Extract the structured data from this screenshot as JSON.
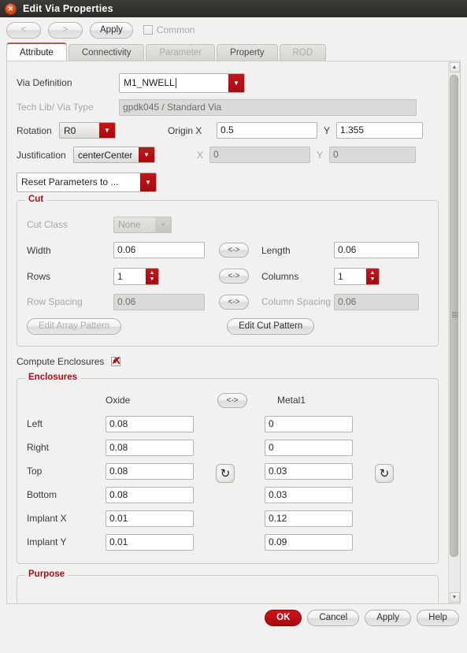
{
  "window": {
    "title": "Edit Via Properties",
    "close_icon": "close-icon"
  },
  "toolbar": {
    "prev_label": "<",
    "next_label": ">",
    "apply_label": "Apply",
    "common_label": "Common",
    "common_checked": false
  },
  "tabs": [
    {
      "label": "Attribute",
      "state": "active"
    },
    {
      "label": "Connectivity",
      "state": "enabled"
    },
    {
      "label": "Parameter",
      "state": "disabled"
    },
    {
      "label": "Property",
      "state": "enabled"
    },
    {
      "label": "ROD",
      "state": "disabled"
    }
  ],
  "attribute": {
    "via_definition_label": "Via Definition",
    "via_definition_value": "M1_NWELL",
    "tech_lib_label": "Tech Lib/ Via Type",
    "tech_lib_value": "gpdk045 / Standard Via",
    "rotation_label": "Rotation",
    "rotation_value": "R0",
    "origin_x_label": "Origin X",
    "origin_x_value": "0.5",
    "origin_y_label": "Y",
    "origin_y_value": "1.355",
    "justification_label": "Justification",
    "justification_value": "centerCenter",
    "just_x_label": "X",
    "just_x_value": "0",
    "just_y_label": "Y",
    "just_y_value": "0",
    "reset_label": "Reset Parameters to ..."
  },
  "cut": {
    "title": "Cut",
    "cut_class_label": "Cut Class",
    "cut_class_value": "None",
    "width_label": "Width",
    "width_value": "0.06",
    "length_label": "Length",
    "length_value": "0.06",
    "rows_label": "Rows",
    "rows_value": "1",
    "columns_label": "Columns",
    "columns_value": "1",
    "row_spacing_label": "Row Spacing",
    "row_spacing_value": "0.06",
    "column_spacing_label": "Column Spacing",
    "column_spacing_value": "0.06",
    "edit_array_label": "Edit Array Pattern",
    "edit_cut_label": "Edit Cut Pattern",
    "swap_label": "<->"
  },
  "compute_enclosures": {
    "label": "Compute Enclosures",
    "checked": true
  },
  "enclosures": {
    "title": "Enclosures",
    "col_left_header": "Oxide",
    "col_right_header": "Metal1",
    "swap_label": "<->",
    "rotate_icon": "rotate-arrow-icon",
    "rows": [
      {
        "label": "Left",
        "oxide": "0.08",
        "metal1": "0"
      },
      {
        "label": "Right",
        "oxide": "0.08",
        "metal1": "0"
      },
      {
        "label": "Top",
        "oxide": "0.08",
        "metal1": "0.03"
      },
      {
        "label": "Bottom",
        "oxide": "0.08",
        "metal1": "0.03"
      },
      {
        "label": "Implant X",
        "oxide": "0.01",
        "metal1": "0.12"
      },
      {
        "label": "Implant Y",
        "oxide": "0.01",
        "metal1": "0.09"
      }
    ]
  },
  "purpose": {
    "title": "Purpose"
  },
  "scrollbar": {
    "up_icon": "chevron-up-icon",
    "down_icon": "chevron-down-icon"
  },
  "footer": {
    "ok_label": "OK",
    "cancel_label": "Cancel",
    "apply_label": "Apply",
    "help_label": "Help"
  },
  "colors": {
    "accent_red": "#a6090f",
    "group_title_red": "#a4111a",
    "titlebar": "#2b2a27"
  }
}
